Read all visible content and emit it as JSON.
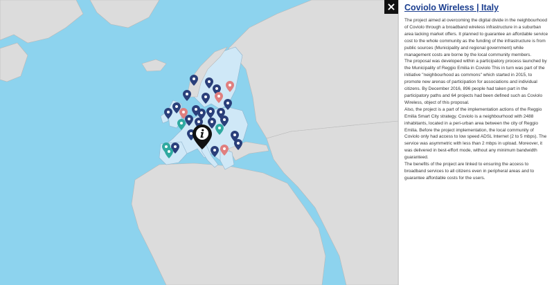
{
  "panel": {
    "close_label": "×",
    "title": "Coviolo Wireless | Italy",
    "paragraphs": [
      "The project aimed at overcoming the digital divide in the neighbourhood of Coviolo through a broadband wireless infrastructure in a suburban area lacking market offers. It planned to guarantee an affordable service cost to the whole community as the funding of the infrastructure is from public sources (Municipality and regional government) while management costs are borne by the local community members.",
      "The proposal was developed within a participatory process launched by the Municipality of Reggio Emilia in Coviolo This in turn was part of the initiative \"neighbourhood as commons\" which started in 2015, to promote new arenas of participation for associations and individual citizens. By December 2016, 896 people had taken part in the participatory paths and 64 projects had been defined such as Coviolo Wireless, object of this proposal.",
      "Also, the project is a part of the implementation actions of the Reggio Emilia Smart City strategy. Coviolo is a neighbourhood with 2488 inhabitants, located in a peri-urban area between the city of Reggio Emilia. Before the project implementation, the local community of Coviolo only had access to low speed ADSL Internet (2 to 5 mbps). The service was asymmetric with less than 2 mbps in upload. Moreover, it was delivered in best-effort mode, without any minimum bandwidth guaranteed.",
      "The benefits of the project are linked to ensuring the access to broadband services to all citizens even in peripheral areas and to guarantee affordable costs for the users."
    ]
  },
  "map": {
    "water_color": "#8dd3ee",
    "land_color": "#dcdcdc",
    "eu_color": "#cfe8f7",
    "pin_colors": {
      "navy": "#2a3f7a",
      "pink": "#e07f7f",
      "teal": "#2fa9a0",
      "active": "#111111"
    },
    "active_pin_icon": "info-icon",
    "pin_icon": "map-pin-icon"
  }
}
